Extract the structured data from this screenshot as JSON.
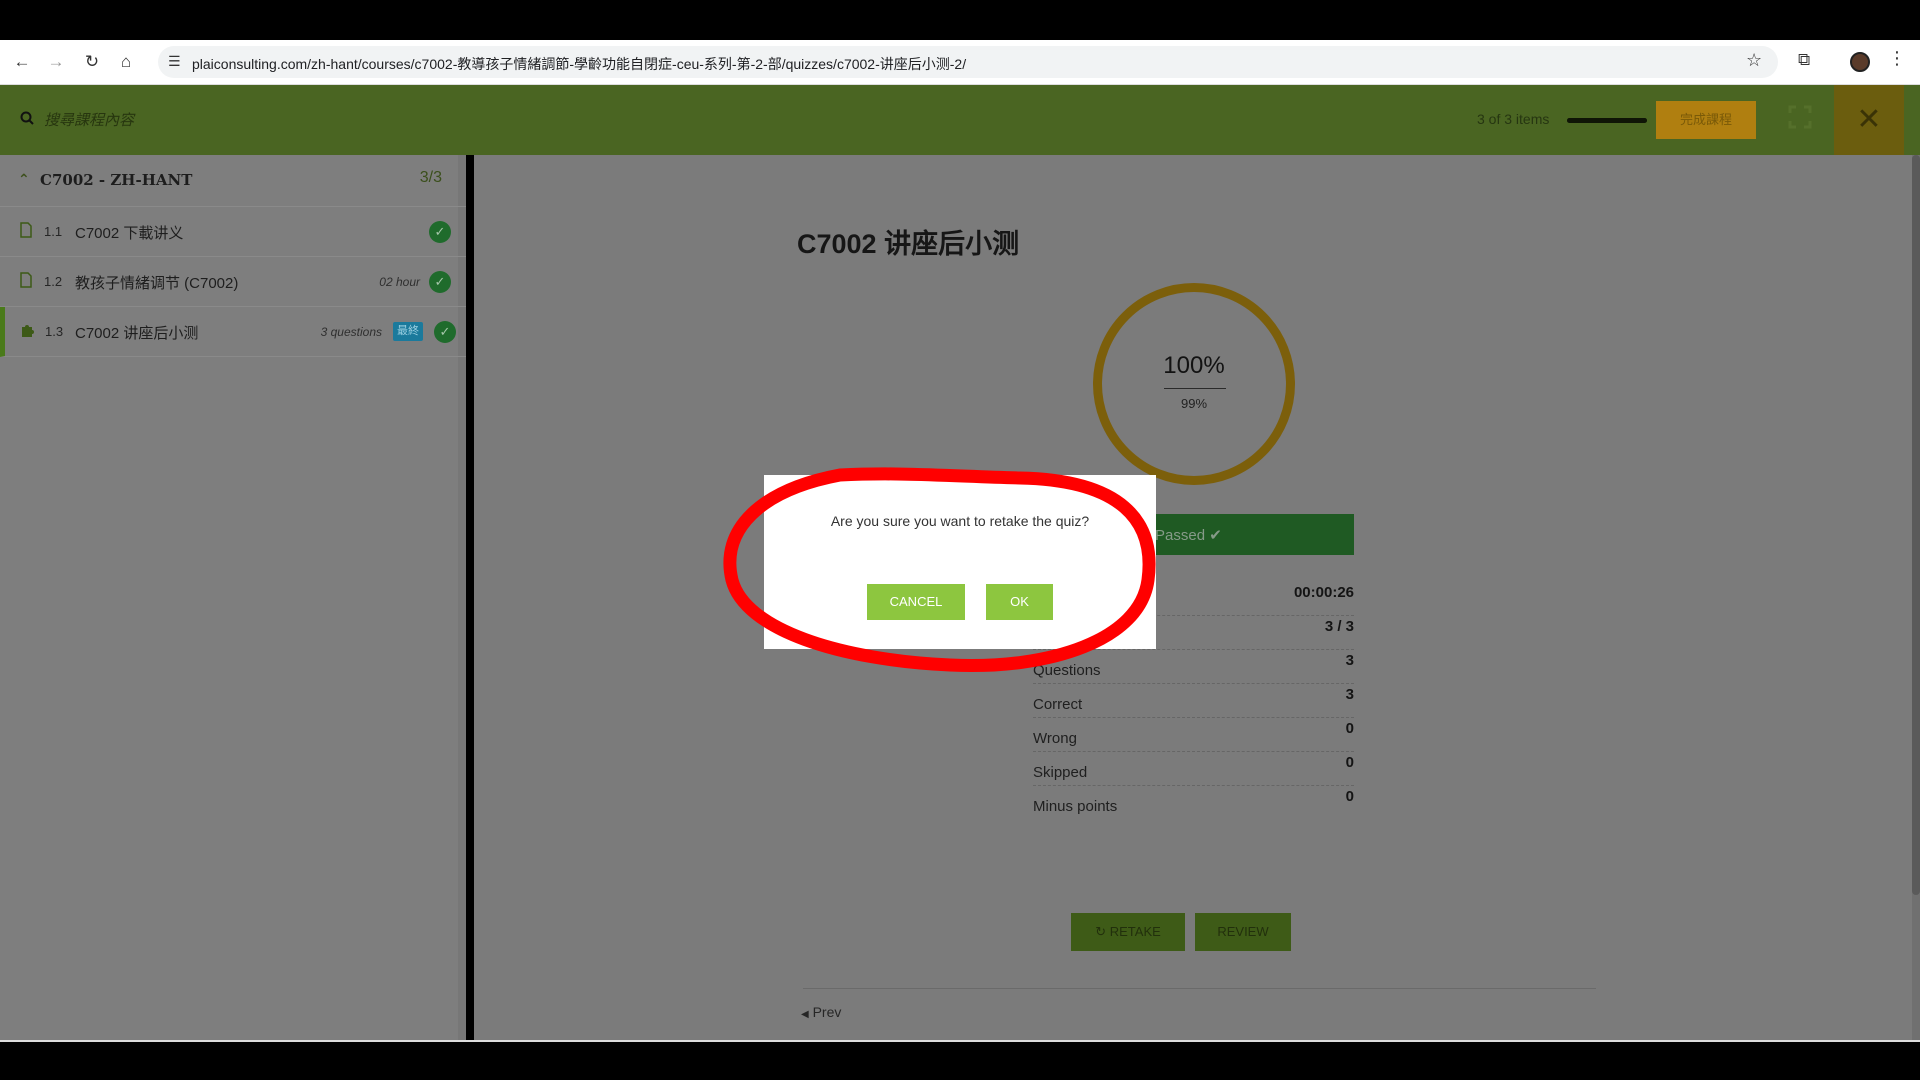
{
  "browser": {
    "url": "plaiconsulting.com/zh-hant/courses/c7002-教導孩子情緒調節-學齡功能自閉症-ceu-系列-第-2-部/quizzes/c7002-讲座后小测-2/"
  },
  "header": {
    "search_placeholder": "搜尋課程內容",
    "items_count": "3 of 3 items",
    "progress_fraction": 1.0,
    "complete_label": "完成課程"
  },
  "sidebar": {
    "section_title": "C7002 - ZH-HANT",
    "section_count": "3/3",
    "lessons": [
      {
        "num": "1.1",
        "title": "C7002 下載讲义",
        "meta": "",
        "badge": "",
        "icon": "file-icon"
      },
      {
        "num": "1.2",
        "title": "教孩子情緒调节 (C7002)",
        "meta": "02 hour",
        "badge": "",
        "icon": "file-icon"
      },
      {
        "num": "1.3",
        "title": "C7002 讲座后小测",
        "meta": "3 questions",
        "badge": "最終",
        "icon": "puzzle-icon"
      }
    ]
  },
  "quiz": {
    "title": "C7002 讲座后小测",
    "result_percent": "100%",
    "passing_percent": "99%",
    "status": "Passed",
    "stats": [
      {
        "label": "",
        "value": "00:00:26"
      },
      {
        "label": "",
        "value": "3 / 3"
      },
      {
        "label": "Questions",
        "value": "3"
      },
      {
        "label": "Correct",
        "value": "3"
      },
      {
        "label": "Wrong",
        "value": "0"
      },
      {
        "label": "Skipped",
        "value": "0"
      },
      {
        "label": "Minus points",
        "value": "0"
      }
    ],
    "retake_label": "RETAKE",
    "review_label": "REVIEW",
    "prev_label": "Prev"
  },
  "dialog": {
    "message": "Are you sure you want to retake the quiz?",
    "cancel_label": "CANCEL",
    "ok_label": "OK"
  },
  "colors": {
    "header_green": "#4a6522",
    "accent_green": "#8dc63f",
    "annotation_red": "#ff0000",
    "ring_gold": "#7c5f0b"
  }
}
